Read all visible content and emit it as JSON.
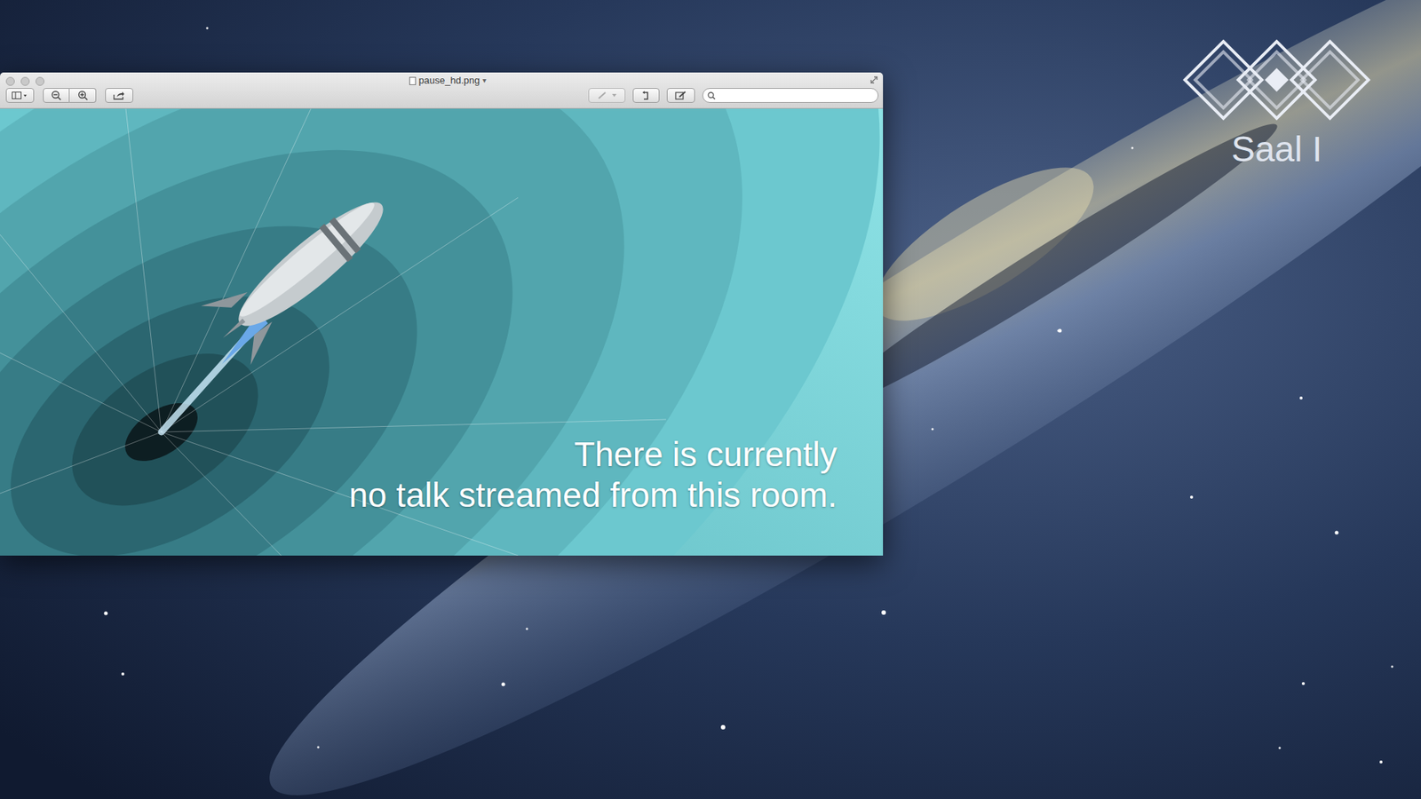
{
  "window": {
    "title": "pause_hd.png",
    "title_menu": "▾"
  },
  "image": {
    "caption": [
      "There is currently",
      "no talk streamed from this room."
    ]
  },
  "logo": {
    "room": "Saal I"
  }
}
